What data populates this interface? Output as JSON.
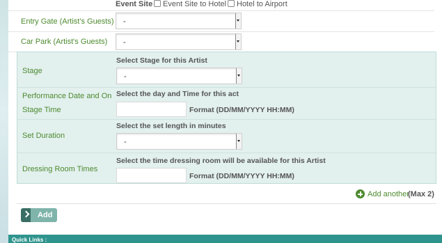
{
  "transfer": {
    "event_site": "Event Site",
    "event_site_to_hotel": "Event Site to Hotel",
    "hotel_to_airport": "Hotel to Airport"
  },
  "entry_gate": {
    "label": "Entry Gate (Artist's Guests)",
    "value": "-"
  },
  "car_park": {
    "label": "Car Park (Artist's Guests)",
    "value": "-"
  },
  "stage": {
    "label": "Stage",
    "hint": "Select Stage for this Artist",
    "value": "-"
  },
  "performance": {
    "label_line1": "Performance Date and On",
    "label_line2": "Stage Time",
    "hint": "Select the day and Time for this act",
    "value": "",
    "format": "Format (DD/MM/YYYY HH:MM)"
  },
  "set_duration": {
    "label": "Set Duration",
    "hint": "Select the set length in minutes",
    "value": "-"
  },
  "dressing_room": {
    "label": "Dressing Room Times",
    "hint": "Select the time dressing room will be available for this Artist",
    "value": "",
    "format": "Format (DD/MM/YYYY HH:MM)"
  },
  "add_another": {
    "label": "Add another",
    "max": "(Max 2)"
  },
  "add_button": "Add",
  "footer": {
    "quick_links": "Quick Links :"
  },
  "colors": {
    "accent": "#2f948d",
    "label_green": "#4d8a2f",
    "stage_bg": "#e2f0ee"
  }
}
